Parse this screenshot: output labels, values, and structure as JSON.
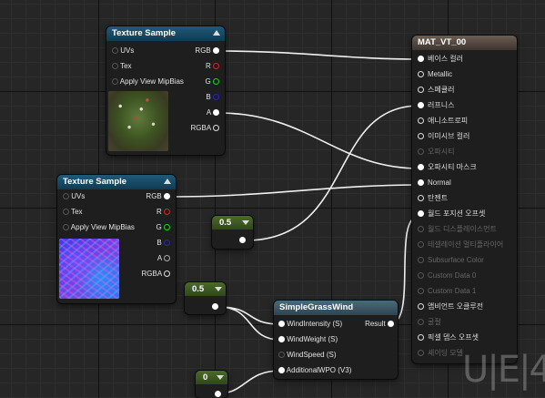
{
  "texture_sample_1": {
    "title": "Texture Sample",
    "pins_in": [
      "UVs",
      "Tex",
      "Apply View MipBias"
    ],
    "pins_out": [
      "RGB",
      "R",
      "G",
      "B",
      "A",
      "RGBA"
    ],
    "thumbnail": "foliage-shrub-texture"
  },
  "texture_sample_2": {
    "title": "Texture Sample",
    "pins_in": [
      "UVs",
      "Tex",
      "Apply View MipBias"
    ],
    "pins_out": [
      "RGB",
      "R",
      "G",
      "B",
      "A",
      "RGBA"
    ],
    "thumbnail": "normal-map-texture"
  },
  "constant_1": {
    "value": "0.5"
  },
  "constant_2": {
    "value": "0.5"
  },
  "constant_3": {
    "value": "0"
  },
  "simple_grass_wind": {
    "title": "SimpleGrassWind",
    "inputs": [
      "WindIntensity (S)",
      "WindWeight (S)",
      "WindSpeed (S)",
      "AdditionalWPO (V3)"
    ],
    "output": "Result"
  },
  "material": {
    "title": "MAT_VT_00",
    "pins": [
      {
        "label": "베이스 컬러",
        "enabled": true,
        "connected": true
      },
      {
        "label": "Metallic",
        "enabled": true,
        "connected": false
      },
      {
        "label": "스페큘러",
        "enabled": true,
        "connected": false
      },
      {
        "label": "러프니스",
        "enabled": true,
        "connected": true
      },
      {
        "label": "애니소트로피",
        "enabled": true,
        "connected": false
      },
      {
        "label": "이미시브 컬러",
        "enabled": true,
        "connected": false
      },
      {
        "label": "오파시티",
        "enabled": false,
        "connected": false
      },
      {
        "label": "오파시티 마스크",
        "enabled": true,
        "connected": true
      },
      {
        "label": "Normal",
        "enabled": true,
        "connected": true
      },
      {
        "label": "탄젠트",
        "enabled": true,
        "connected": false
      },
      {
        "label": "월드 포지션 오프셋",
        "enabled": true,
        "connected": true
      },
      {
        "label": "월드 디스플레이스먼트",
        "enabled": false,
        "connected": false
      },
      {
        "label": "테셀레이션 멀티플라이어",
        "enabled": false,
        "connected": false
      },
      {
        "label": "Subsurface Color",
        "enabled": false,
        "connected": false
      },
      {
        "label": "Custom Data 0",
        "enabled": false,
        "connected": false
      },
      {
        "label": "Custom Data 1",
        "enabled": false,
        "connected": false
      },
      {
        "label": "앰비언트 오클루전",
        "enabled": true,
        "connected": false
      },
      {
        "label": "굴절",
        "enabled": false,
        "connected": false
      },
      {
        "label": "픽셀 뎁스 오프셋",
        "enabled": true,
        "connected": false
      },
      {
        "label": "셰이딩 모델",
        "enabled": false,
        "connected": false
      }
    ]
  },
  "watermark": "U|E|4"
}
